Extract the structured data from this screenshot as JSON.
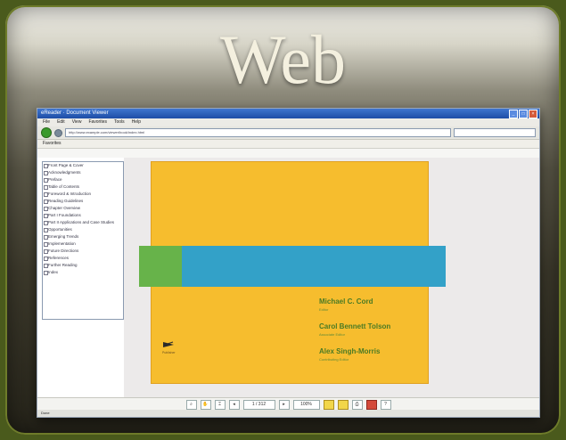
{
  "heading": "Web",
  "browser": {
    "title": "eReader  ·  Document Viewer",
    "menu": [
      "File",
      "Edit",
      "View",
      "Favorites",
      "Tools",
      "Help"
    ],
    "address": "http://www.example.com/viewer/book/index.html",
    "favorites_label": "Favorites",
    "status": "Done"
  },
  "sidebar": {
    "items": [
      "Front Page & Cover",
      "Acknowledgments",
      "Preface",
      "Table of Contents",
      "Foreword & Introduction",
      "Reading Guidelines",
      "Chapter Overview",
      "Part I  Foundations",
      "Part II  Applications and Case Studies",
      "Opportunities",
      "Emerging Trends",
      "Implementation",
      "Future Directions",
      "References",
      "Further Reading",
      "Index"
    ]
  },
  "cover": {
    "authors": [
      {
        "name": "Michael C. Cord",
        "affiliation": "Editor"
      },
      {
        "name": "Carol Bennett Tolson",
        "affiliation": "Associate Editor"
      },
      {
        "name": "Alex Singh-Morris",
        "affiliation": "Contributing Editor"
      }
    ],
    "publisher_text": "Publisher"
  },
  "toolbar": {
    "page_field": "1 / 312",
    "zoom_field": "100%"
  },
  "colors": {
    "cover_bg": "#f6bd2e",
    "band_blue": "#33a1c8",
    "band_green": "#67b34a",
    "author_text": "#4a7a24"
  }
}
